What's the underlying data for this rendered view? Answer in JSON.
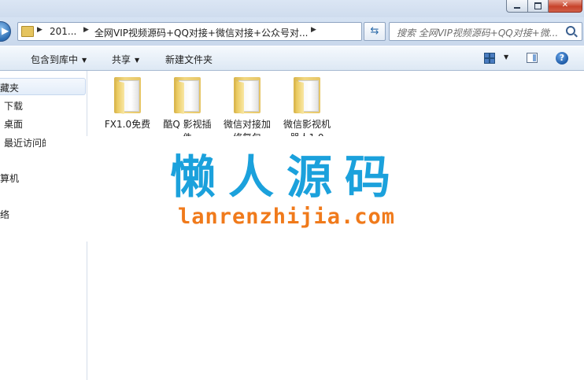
{
  "address_bar": {
    "crumbs": [
      "201...",
      "全网VIP视频源码+QQ对接+微信对接+公众号对..."
    ]
  },
  "search": {
    "placeholder": "搜索 全网VIP视频源码+QQ对接+微..."
  },
  "toolbar": {
    "include_in_library": "包含到库中",
    "share": "共享",
    "new_folder": "新建文件夹"
  },
  "nav": {
    "favorites": "收藏夹",
    "downloads": "下载",
    "desktop": "桌面",
    "recent": "最近访问的",
    "computer": "计算机",
    "network": "网络"
  },
  "files": [
    {
      "line1": "FX1.0免费",
      "line2": ""
    },
    {
      "line1": "酷Q 影视插",
      "line2": "件"
    },
    {
      "line1": "微信对接加",
      "line2": "修复包"
    },
    {
      "line1": "微信影视机",
      "line2": "器人1.0"
    }
  ],
  "watermark": {
    "title": "懒人源码",
    "url": "lanrenzhijia.com"
  },
  "colors": {
    "watermark_title": "#1ba1dc",
    "watermark_url": "#f07a1b",
    "folder": "#e6c566"
  }
}
